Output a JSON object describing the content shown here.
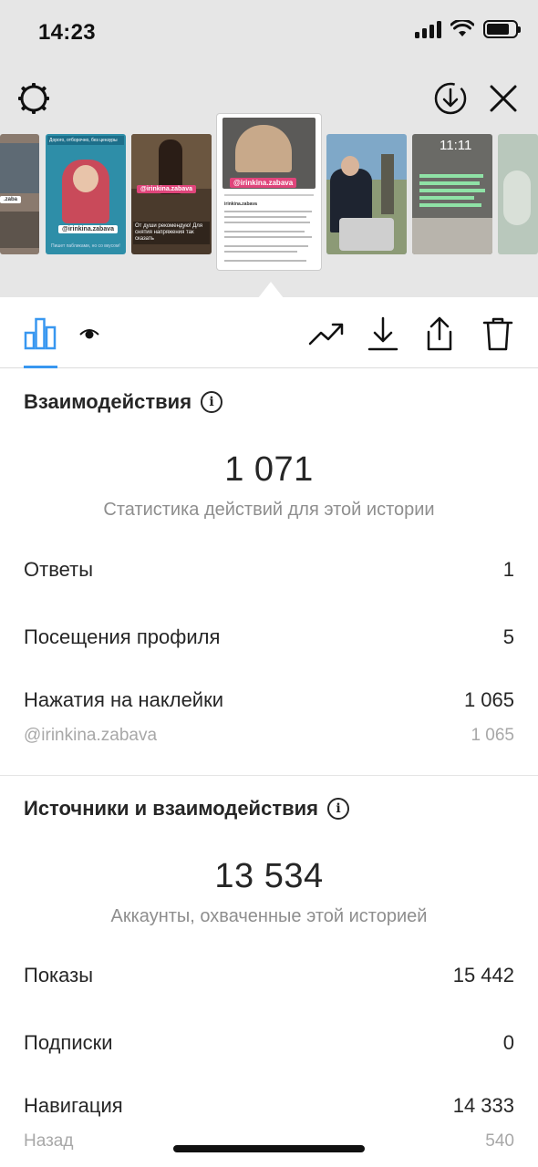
{
  "status": {
    "time": "14:23"
  },
  "thumbnails": {
    "t2_top": "Дорого, отборочно, без цензуры",
    "t2_tag": "@irinkina.zabava",
    "t2_bottom": "Пишет пабликами, но со вкусом!",
    "t3_tag": "@irinkina.zabava",
    "t3_bottom": "От души рекомендую! Для снятия напряжения так сказать",
    "active_tag": "@irinkina.zabava",
    "active_handle": "irinkina.zabava",
    "t5_time": "11:11"
  },
  "toolbar": {},
  "interactions": {
    "title": "Взаимодействия",
    "total": "1 071",
    "caption": "Статистика действий для этой истории",
    "rows": [
      {
        "label": "Ответы",
        "value": "1"
      },
      {
        "label": "Посещения профиля",
        "value": "5"
      },
      {
        "label": "Нажатия на наклейки",
        "value": "1 065"
      }
    ],
    "sub_row": {
      "label": "@irinkina.zabava",
      "value": "1 065"
    }
  },
  "discovery": {
    "title": "Источники и взаимодействия",
    "total": "13 534",
    "caption": "Аккаунты, охваченные этой историей",
    "rows": [
      {
        "label": "Показы",
        "value": "15 442"
      },
      {
        "label": "Подписки",
        "value": "0"
      },
      {
        "label": "Навигация",
        "value": "14 333"
      }
    ],
    "sub_row": {
      "label": "Назад",
      "value": "540"
    }
  },
  "colors": {
    "accent": "#3897f0",
    "text": "#262626",
    "muted": "#8e8e8e"
  }
}
